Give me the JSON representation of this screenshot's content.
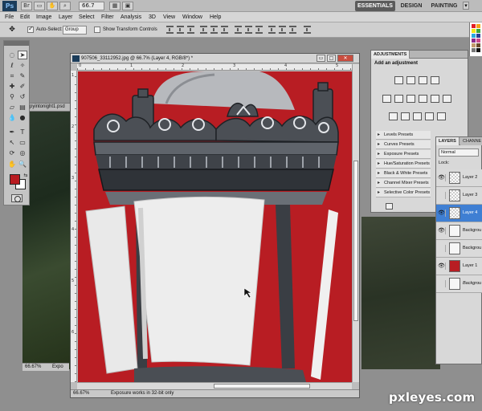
{
  "app": {
    "logo": "Ps",
    "zoom": "66.7",
    "workspaces": [
      "ESSENTIALS",
      "DESIGN",
      "PAINTING"
    ],
    "window_controls": [
      "▾",
      "–",
      "□"
    ]
  },
  "menu": [
    "File",
    "Edit",
    "Image",
    "Layer",
    "Select",
    "Filter",
    "Analysis",
    "3D",
    "View",
    "Window",
    "Help"
  ],
  "options": {
    "auto_select_label": "Auto-Select:",
    "auto_select_value": "Group",
    "show_transform_label": "Show Transform Controls"
  },
  "background_doc": {
    "tab_label": "pyintonight1.psd",
    "zoom": "66.67%",
    "status": "Expo"
  },
  "document": {
    "title": "907506_33112952.jpg @ 66.7% (Layer 4, RGB/8*) *",
    "zoom_status": "66.67%",
    "status_info": "Exposure works in 32-bit only",
    "ruler_top": [
      "0",
      "1",
      "2",
      "3",
      "4",
      "5"
    ],
    "ruler_left": [
      "1",
      "2",
      "3",
      "4",
      "5",
      "6"
    ],
    "window_buttons": [
      "▭",
      "□",
      "✕"
    ]
  },
  "adjustments": {
    "tab": "ADJUSTMENTS",
    "heading": "Add an adjustment",
    "presets": [
      "Levels Presets",
      "Curves Presets",
      "Exposure Presets",
      "Hue/Saturation Presets",
      "Black & White Presets",
      "Channel Mixer Presets",
      "Selective Color Presets"
    ]
  },
  "layers": {
    "tabs": [
      "LAYERS",
      "CHANNE"
    ],
    "blend_mode": "Normal",
    "lock_label": "Lock:",
    "rows": [
      {
        "name": "Layer 2",
        "eye": "👁",
        "thumb": "transparent",
        "selected": false
      },
      {
        "name": "Layer 3",
        "eye": "",
        "thumb": "transparent",
        "selected": false
      },
      {
        "name": "Layer 4",
        "eye": "👁",
        "thumb": "transparent",
        "selected": true
      },
      {
        "name": "Backgrou",
        "eye": "👁",
        "thumb": "lamp",
        "selected": false
      },
      {
        "name": "Backgrou",
        "eye": "",
        "thumb": "lamp",
        "selected": false
      },
      {
        "name": "Layer 1",
        "eye": "👁",
        "thumb": "red",
        "selected": false
      },
      {
        "name": "Backgrou",
        "eye": "",
        "thumb": "lamp",
        "selected": false,
        "italic": true
      }
    ]
  },
  "colors": {
    "foreground": "#b81b20",
    "background": "#ffffff",
    "canvas_red": "#b81d23",
    "selected_layer": "#3f7fd3"
  },
  "watermark": "pxleyes.com"
}
